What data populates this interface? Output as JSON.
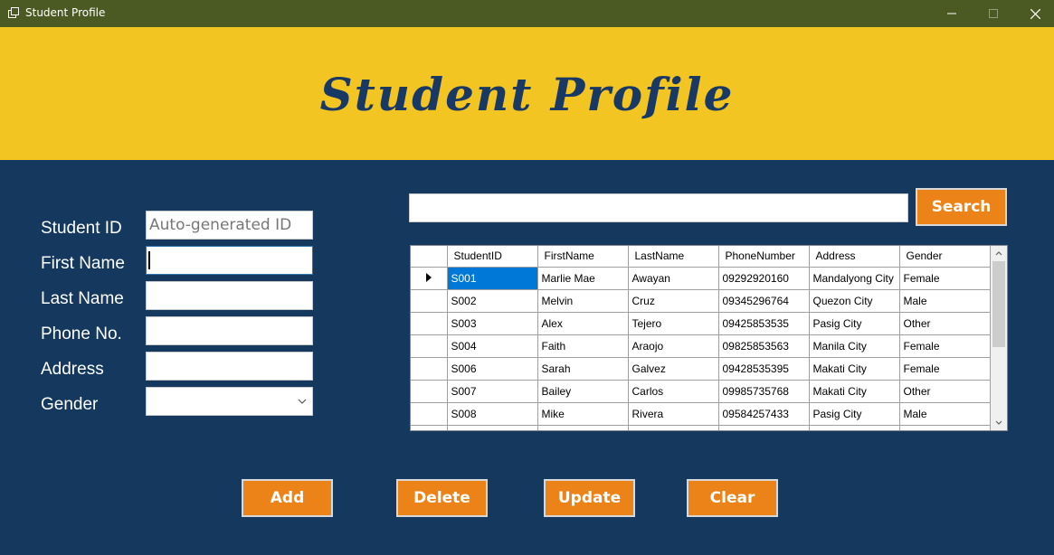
{
  "window": {
    "title": "Student Profile",
    "controls": {
      "minimize": "—",
      "maximize": "☐",
      "close": "✕"
    }
  },
  "banner": {
    "title": "Student Profile"
  },
  "form": {
    "student_id_label": "Student ID",
    "student_id_placeholder": "Auto-generated ID",
    "first_name_label": "First Name",
    "first_name_value": "",
    "last_name_label": "Last Name",
    "last_name_value": "",
    "phone_label": "Phone No.",
    "phone_value": "",
    "address_label": "Address",
    "address_value": "",
    "gender_label": "Gender",
    "gender_value": ""
  },
  "search": {
    "value": "",
    "button_label": "Search"
  },
  "grid": {
    "columns": [
      "StudentID",
      "FirstName",
      "LastName",
      "PhoneNumber",
      "Address",
      "Gender"
    ],
    "rows": [
      [
        "S001",
        "Marlie Mae",
        "Awayan",
        "09292920160",
        "Mandalyong City",
        "Female"
      ],
      [
        "S002",
        "Melvin",
        "Cruz",
        "09345296764",
        "Quezon City",
        "Male"
      ],
      [
        "S003",
        "Alex",
        "Tejero",
        "09425853535",
        "Pasig City",
        "Other"
      ],
      [
        "S004",
        "Faith",
        "Araojo",
        "09825853563",
        "Manila City",
        "Female"
      ],
      [
        "S006",
        "Sarah",
        "Galvez",
        "09428535395",
        "Makati City",
        "Female"
      ],
      [
        "S007",
        "Bailey",
        "Carlos",
        "09985735768",
        "Makati City",
        "Other"
      ],
      [
        "S008",
        "Mike",
        "Rivera",
        "09584257433",
        "Pasig City",
        "Male"
      ]
    ],
    "selected_row": 0
  },
  "actions": {
    "add": "Add",
    "delete": "Delete",
    "update": "Update",
    "clear": "Clear"
  },
  "colors": {
    "background": "#14385e",
    "banner": "#f2c522",
    "button": "#ec8318",
    "titlebar": "#4b5a22",
    "selection": "#0078d7"
  }
}
